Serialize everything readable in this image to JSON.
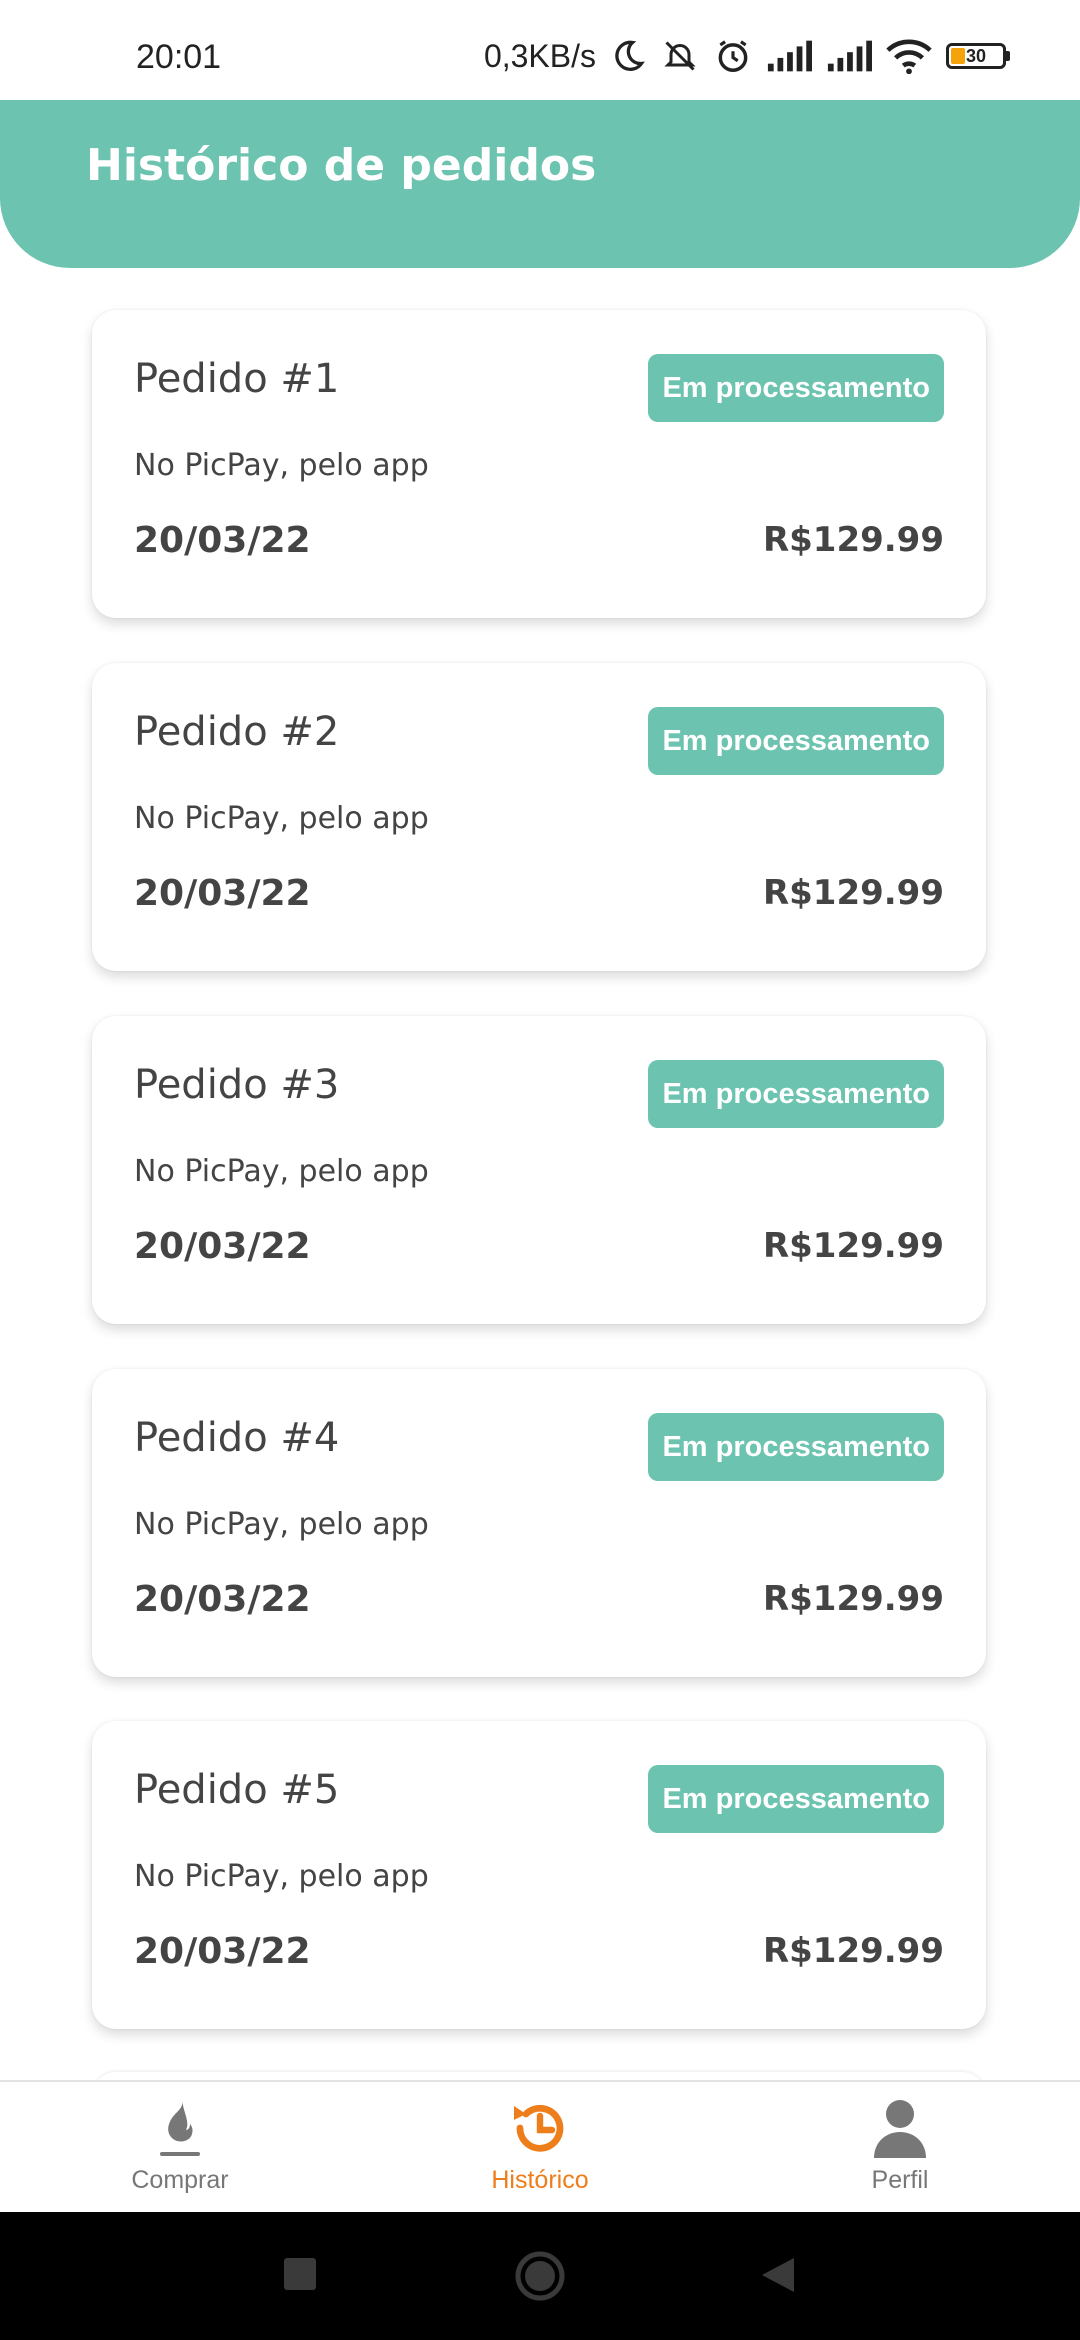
{
  "status_bar": {
    "time": "20:01",
    "network_speed": "0,3KB/s",
    "battery_level": "30",
    "icons": [
      "moon-icon",
      "mute-icon",
      "alarm-icon",
      "signal-icon",
      "signal-icon",
      "wifi-icon",
      "battery-icon"
    ]
  },
  "header": {
    "title": "Histórico de pedidos"
  },
  "orders": [
    {
      "title": "Pedido #1",
      "status": "Em processamento",
      "method": "No PicPay, pelo app",
      "date": "20/03/22",
      "price": "R$129.99"
    },
    {
      "title": "Pedido #2",
      "status": "Em processamento",
      "method": "No PicPay, pelo app",
      "date": "20/03/22",
      "price": "R$129.99"
    },
    {
      "title": "Pedido #3",
      "status": "Em processamento",
      "method": "No PicPay, pelo app",
      "date": "20/03/22",
      "price": "R$129.99"
    },
    {
      "title": "Pedido #4",
      "status": "Em processamento",
      "method": "No PicPay, pelo app",
      "date": "20/03/22",
      "price": "R$129.99"
    },
    {
      "title": "Pedido #5",
      "status": "Em processamento",
      "method": "No PicPay, pelo app",
      "date": "20/03/22",
      "price": "R$129.99"
    }
  ],
  "bottom_nav": {
    "items": [
      {
        "label": "Comprar",
        "icon": "flame-icon",
        "active": false
      },
      {
        "label": "Histórico",
        "icon": "history-icon",
        "active": true
      },
      {
        "label": "Perfil",
        "icon": "user-icon",
        "active": false
      }
    ]
  },
  "colors": {
    "accent": "#6cc3af",
    "active_nav": "#ee7d1b",
    "text": "#444444"
  }
}
